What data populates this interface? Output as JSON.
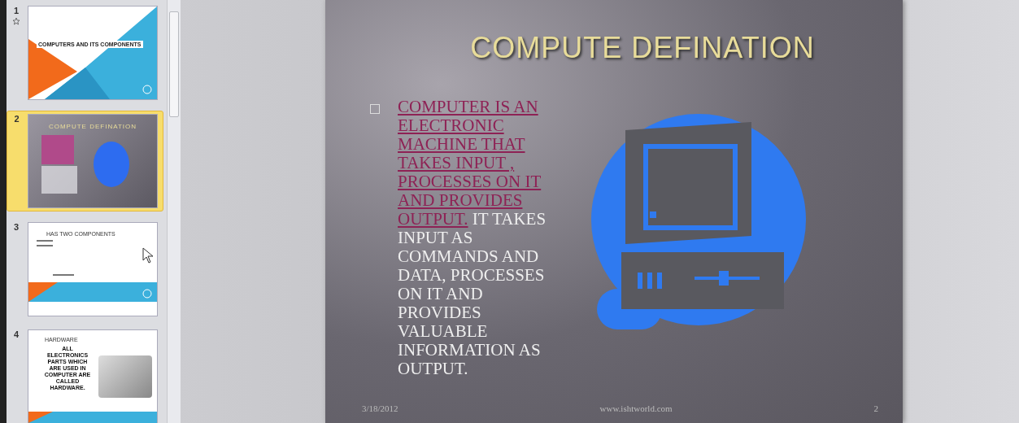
{
  "thumbnails": [
    {
      "number": "1",
      "selected": false,
      "animated": true,
      "kind": "title",
      "title": "COMPUTERS AND ITS COMPONENTS"
    },
    {
      "number": "2",
      "selected": true,
      "animated": false,
      "kind": "dark",
      "title": "COMPUTE DEFINATION"
    },
    {
      "number": "3",
      "selected": false,
      "animated": false,
      "kind": "list",
      "title": "HAS TWO COMPONENTS"
    },
    {
      "number": "4",
      "selected": false,
      "animated": false,
      "kind": "picture",
      "title": "HARDWARE",
      "body": "ALL ELECTRONICS PARTS WHICH ARE USED IN COMPUTER ARE CALLED HARDWARE."
    }
  ],
  "slide": {
    "title": "COMPUTE DEFINATION",
    "bullet_link": "COMPUTER IS AN ELECTRONIC MACHINE THAT TAKES INPUT , PROCESSES ON IT AND PROVIDES OUTPUT.",
    "bullet_text": "IT TAKES INPUT AS COMMANDS AND DATA, PROCESSES ON IT AND PROVIDES VALUABLE INFORMATION AS OUTPUT.",
    "date": "3/18/2012",
    "footer": "www.ishtworld.com",
    "number": "2"
  }
}
